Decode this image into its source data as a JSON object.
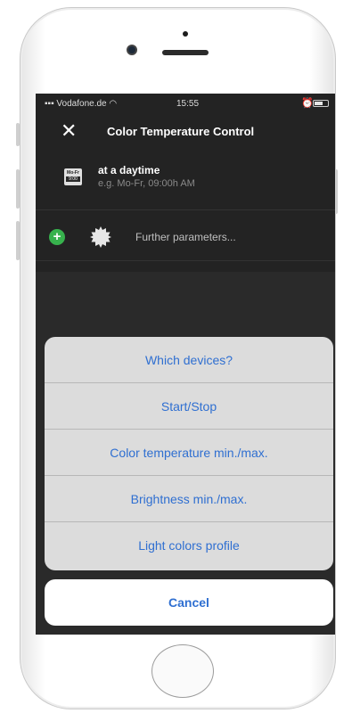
{
  "status_bar": {
    "carrier": "Vodafone.de",
    "wifi_icon": "wifi-icon",
    "time": "15:55",
    "alarm_icon": "alarm-icon",
    "battery_icon": "battery-icon"
  },
  "navbar": {
    "close_icon": "✕",
    "title": "Color Temperature Control"
  },
  "rows": {
    "daytime": {
      "icon_top": "Mo-Fr",
      "icon_bottom": "9:00",
      "title": "at a daytime",
      "subtitle": "e.g. Mo-Fr, 09:00h AM"
    },
    "params": {
      "add_icon": "+",
      "label": "Further parameters..."
    }
  },
  "action_sheet": {
    "items": [
      {
        "label": "Which devices?"
      },
      {
        "label": "Start/Stop"
      },
      {
        "label": "Color temperature min./max."
      },
      {
        "label": "Brightness min./max."
      },
      {
        "label": "Light colors profile"
      }
    ],
    "cancel_label": "Cancel"
  },
  "colors": {
    "accent": "#2f6fd1",
    "add_green": "#37b24d",
    "screen_bg": "#232323"
  }
}
